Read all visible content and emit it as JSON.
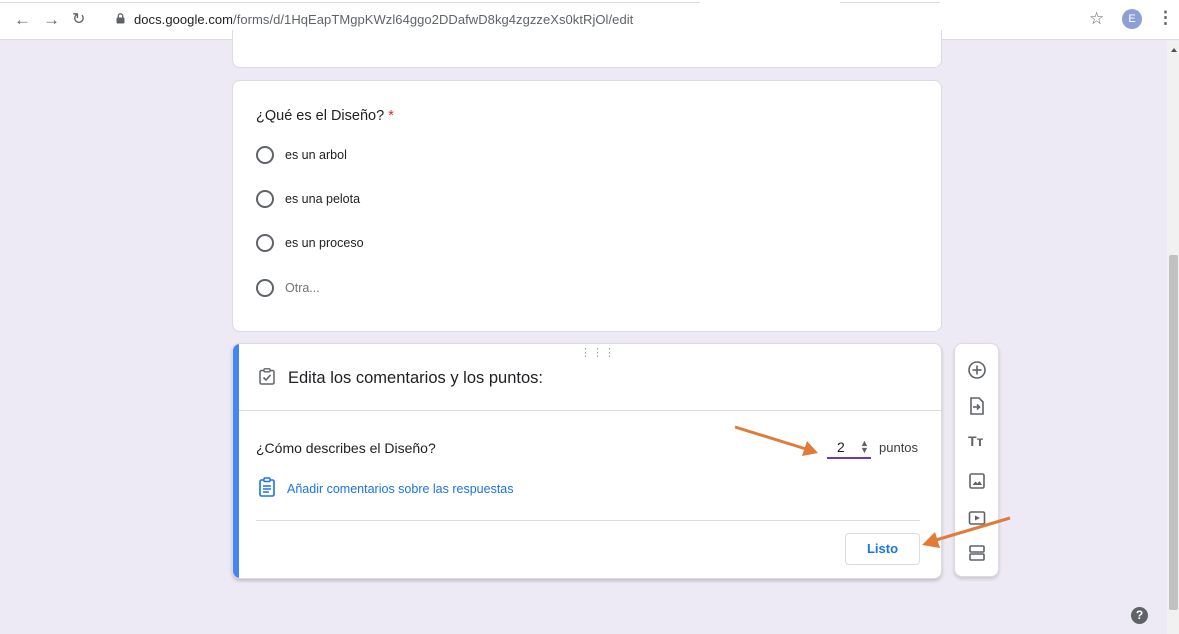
{
  "browser": {
    "url_host": "docs.google.com",
    "url_path": "/forms/d/1HqEapTMgpKWzl64ggo2DDafwD8kg4zgzzeXs0ktRjOl/edit",
    "avatar_letter": "E"
  },
  "question1": {
    "title": "¿Qué es el Diseño?",
    "required_mark": "*",
    "options": [
      "es un arbol",
      "es una pelota",
      "es un proceso",
      "Otra..."
    ]
  },
  "edit_card": {
    "heading": "Edita los comentarios y los puntos:",
    "question_title": "¿Cómo describes el Diseño?",
    "points_value": "2",
    "points_label": "puntos",
    "feedback_link": "Añadir comentarios sobre las respuestas",
    "done_button": "Listo"
  },
  "toolbar": {
    "icons": [
      "add-question-icon",
      "import-questions-icon",
      "add-title-icon",
      "add-image-icon",
      "add-video-icon",
      "add-section-icon"
    ],
    "title_glyph": "Tт"
  },
  "help": {
    "glyph": "?"
  },
  "colors": {
    "page_background": "#ede9f5",
    "accent_blue": "#4285f4",
    "link_blue": "#1a73e8",
    "required_red": "#d93025",
    "points_underline": "#673ab7",
    "annotation_arrow": "#e07b39"
  }
}
